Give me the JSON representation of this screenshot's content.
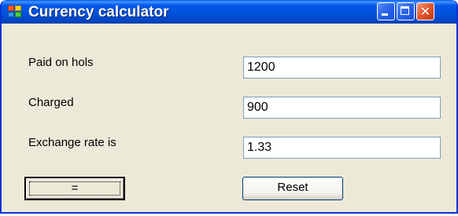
{
  "window": {
    "title": "Currency calculator",
    "icon": "app-grid-icon",
    "controls": [
      "minimize-icon",
      "maximize-icon",
      "close-icon"
    ],
    "close_glyph": "✕"
  },
  "form": {
    "paid": {
      "label": "Paid on hols",
      "value": "1200"
    },
    "charged": {
      "label": "Charged",
      "value": "900"
    },
    "rate": {
      "label": "Exchange rate is",
      "value": "1.33"
    }
  },
  "buttons": {
    "equals_label": "=",
    "reset_label": "Reset"
  },
  "colors": {
    "title_bar": "#0252dd",
    "window_face": "#ece9d8",
    "close_button": "#e1542b",
    "field_border": "#7f9db9"
  }
}
